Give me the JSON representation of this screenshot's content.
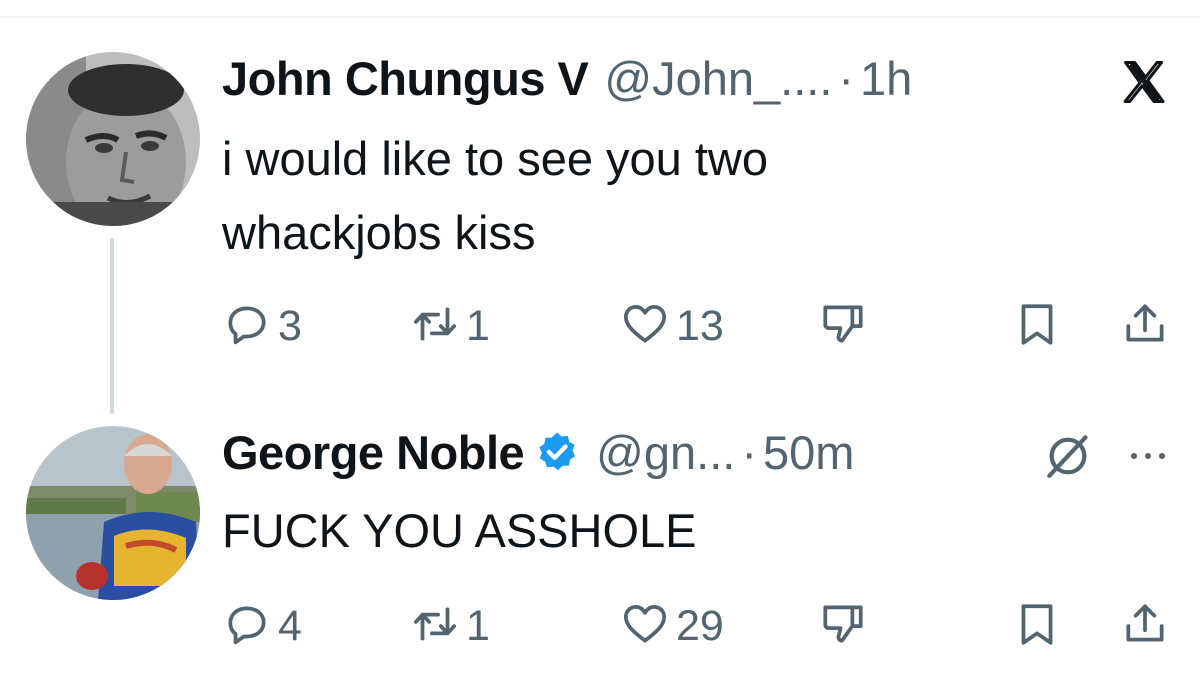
{
  "window": {
    "close_icon": "x-logo-icon"
  },
  "tweets": [
    {
      "author": {
        "name": "John Chungus V",
        "handle": "@John_....",
        "verified": false,
        "avatar": "avatar-older-man-bw"
      },
      "separator": "·",
      "time": "1h",
      "text_lines": [
        "i would like to see you two",
        "whackjobs kiss"
      ],
      "stats": {
        "replies": "3",
        "reposts": "1",
        "likes": "13"
      },
      "corner_icon": "x-logo-icon"
    },
    {
      "author": {
        "name": "George Noble",
        "handle": "@gn...",
        "verified": true,
        "avatar": "avatar-man-cycling-jersey"
      },
      "separator": "·",
      "time": "50m",
      "text_lines": [
        "FUCK YOU ASSHOLE"
      ],
      "stats": {
        "replies": "4",
        "reposts": "1",
        "likes": "29"
      },
      "corner_icon": "grok-icon",
      "more_icon": "more-icon"
    }
  ],
  "colors": {
    "secondary_text": "#536471",
    "verified_blue": "#1d9bf0",
    "thread_line": "#cfd9de"
  }
}
